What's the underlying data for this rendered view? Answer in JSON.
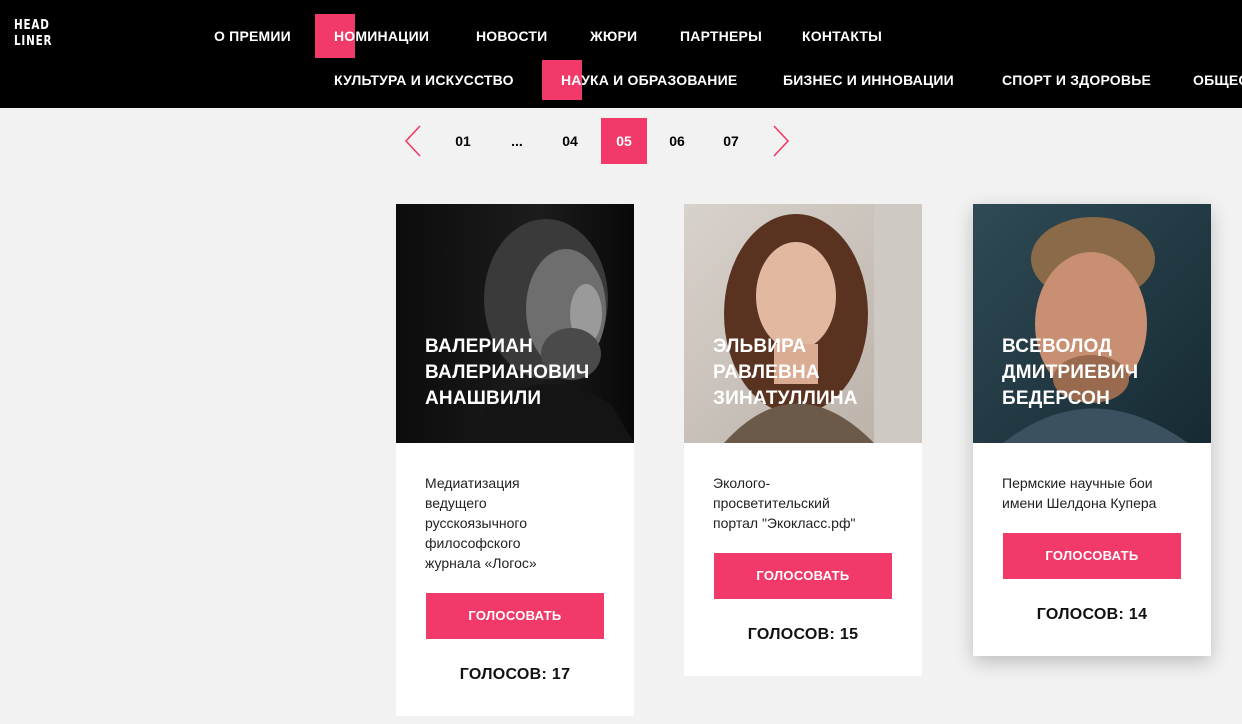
{
  "header": {
    "logo": [
      "HEAD",
      "LINER"
    ],
    "nav": [
      {
        "label": "О ПРЕМИИ"
      },
      {
        "label": "НОМИНАЦИИ"
      },
      {
        "label": "НОВОСТИ"
      },
      {
        "label": "ЖЮРИ"
      },
      {
        "label": "ПАРТНЕРЫ"
      },
      {
        "label": "КОНТАКТЫ"
      }
    ],
    "subnav": [
      {
        "label": "КУЛЬТУРА И ИСКУССТВО"
      },
      {
        "label": "НАУКА И ОБРАЗОВАНИЕ"
      },
      {
        "label": "БИЗНЕС И ИННОВАЦИИ"
      },
      {
        "label": "СПОРТ И ЗДОРОВЬЕ"
      },
      {
        "label": "ОБЩЕС"
      }
    ],
    "accent_color": "#f13a69"
  },
  "pagination": {
    "pages": [
      "01",
      "...",
      "04",
      "05",
      "06",
      "07"
    ],
    "current": "05",
    "prev_icon": "chevron-left-icon",
    "next_icon": "chevron-right-icon"
  },
  "candidates": [
    {
      "name": "Валериан Валерианович Анашвили",
      "name_lines": [
        "ВАЛЕРИАН",
        "ВАЛЕРИАНОВИЧ",
        "АНАШВИЛИ"
      ],
      "project_lines": [
        "Медиатизация",
        "ведущего",
        "русскоязычного",
        "философского",
        "журнала «Логос»"
      ],
      "vote_label": "ГОЛОСОВАТЬ",
      "votes_text": "ГОЛОСОВ: 17"
    },
    {
      "name": "Эльвира Равлевна Зинатуллина",
      "name_lines": [
        "ЭЛЬВИРА",
        "РАВЛЕВНА",
        "ЗИНАТУЛЛИНА"
      ],
      "project_lines": [
        "Эколого-",
        "просветительский",
        "портал \"Экокласс.рф\""
      ],
      "vote_label": "ГОЛОСОВАТЬ",
      "votes_text": "ГОЛОСОВ: 15"
    },
    {
      "name": "Всеволод Дмитриевич Бедерсон",
      "name_lines": [
        "ВСЕВОЛОД",
        "ДМИТРИЕВИЧ",
        "БЕДЕРСОН"
      ],
      "project_lines": [
        "Пермские научные бои",
        "имени Шелдона Купера"
      ],
      "vote_label": "ГОЛОСОВАТЬ",
      "votes_text": "ГОЛОСОВ: 14"
    }
  ]
}
